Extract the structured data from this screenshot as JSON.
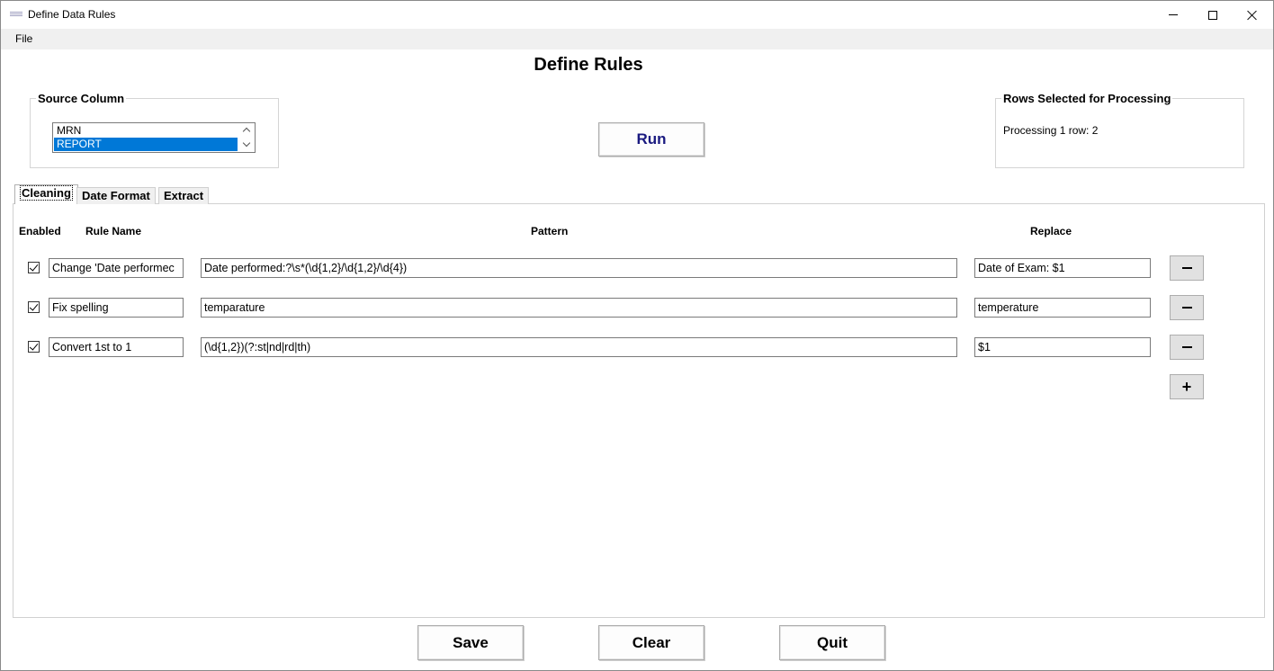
{
  "window": {
    "title": "Define Data Rules"
  },
  "menu": {
    "file": "File"
  },
  "page": {
    "title": "Define Rules"
  },
  "source_column": {
    "label": "Source Column",
    "items": [
      "MRN",
      "REPORT"
    ],
    "selected": "REPORT"
  },
  "rows_selected": {
    "label": "Rows Selected for Processing",
    "text": "Processing 1 row: 2"
  },
  "buttons": {
    "run": "Run",
    "save": "Save",
    "clear": "Clear",
    "quit": "Quit",
    "add": "+"
  },
  "tabs": [
    {
      "label": "Cleaning",
      "active": true
    },
    {
      "label": "Date Format",
      "active": false
    },
    {
      "label": "Extract",
      "active": false
    }
  ],
  "columns": {
    "enabled": "Enabled",
    "rule_name": "Rule Name",
    "pattern": "Pattern",
    "replace": "Replace"
  },
  "rules": [
    {
      "enabled": true,
      "name": "Change 'Date performec",
      "pattern": "Date performed:?\\s*(\\d{1,2}/\\d{1,2}/\\d{4})",
      "replace": "Date of Exam: $1"
    },
    {
      "enabled": true,
      "name": "Fix spelling",
      "pattern": "temparature",
      "replace": "temperature"
    },
    {
      "enabled": true,
      "name": "Convert 1st to 1",
      "pattern": "(\\d{1,2})(?:st|nd|rd|th)",
      "replace": "$1"
    }
  ],
  "colors": {
    "selection": "#0078d7",
    "run_text": "#1a1a80",
    "menubar": "#f0f0f0"
  }
}
